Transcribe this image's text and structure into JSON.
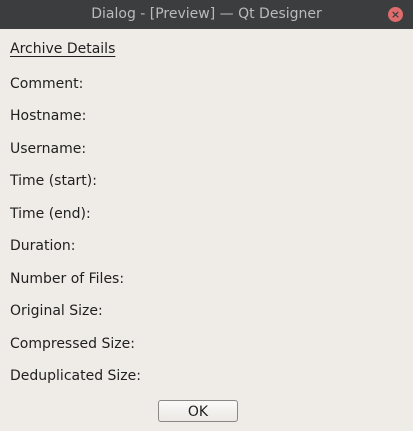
{
  "window": {
    "title": "Dialog - [Preview] — Qt Designer",
    "close_icon": "×"
  },
  "archive": {
    "heading": "Archive Details",
    "fields": [
      {
        "label": "Comment:"
      },
      {
        "label": "Hostname:"
      },
      {
        "label": "Username:"
      },
      {
        "label": "Time (start):"
      },
      {
        "label": "Time (end):"
      },
      {
        "label": "Duration:"
      },
      {
        "label": "Number of Files:"
      },
      {
        "label": "Original Size:"
      },
      {
        "label": "Compressed Size:"
      },
      {
        "label": "Deduplicated Size:"
      }
    ]
  },
  "buttons": {
    "ok_label": "OK"
  },
  "colors": {
    "titlebar_bg": "#3b3d3f",
    "titlebar_text": "#b9bcbd",
    "close_button": "#df6c6c",
    "window_bg": "#efebe7"
  }
}
